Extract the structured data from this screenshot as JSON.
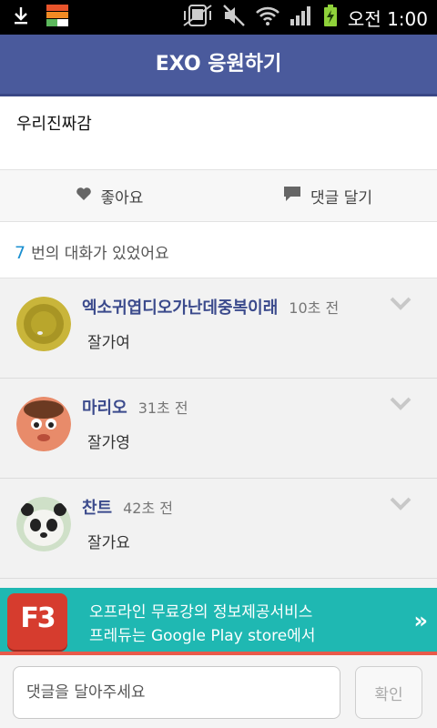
{
  "status_bar": {
    "time": "오전 1:00",
    "icons": [
      "download-icon",
      "app-notification-icon",
      "vibrate-icon",
      "mute-icon",
      "wifi-icon",
      "signal-icon",
      "battery-charging-icon"
    ]
  },
  "app_bar": {
    "title": "EXO 응원하기"
  },
  "post": {
    "text": "우리진짜감"
  },
  "actions": {
    "like_label": "좋아요",
    "comment_label": "댓글 달기"
  },
  "comment_count": {
    "number": "7",
    "text": "번의 대화가 있었어요"
  },
  "comments": [
    {
      "author": "엑소귀엽디오가난데중복이래",
      "time": "10초 전",
      "text": "잘가여"
    },
    {
      "author": "마리오",
      "time": "31초 전",
      "text": "잘가영"
    },
    {
      "author": "찬트",
      "time": "42초 전",
      "text": "잘가요"
    }
  ],
  "ad": {
    "logo_text": "F3",
    "line1": "오프라인 무료강의 정보제공서비스",
    "line2": "프레듀는 Google Play store에서",
    "arrow": "»"
  },
  "input_bar": {
    "placeholder": "댓글을 달아주세요",
    "confirm_label": "확인"
  },
  "colors": {
    "app_bar": "#4a5a9c",
    "author": "#3b4a8c",
    "count_number": "#1a8fd0",
    "ad_background": "#1fb8b2",
    "ad_stripe": "#e85a4a"
  }
}
